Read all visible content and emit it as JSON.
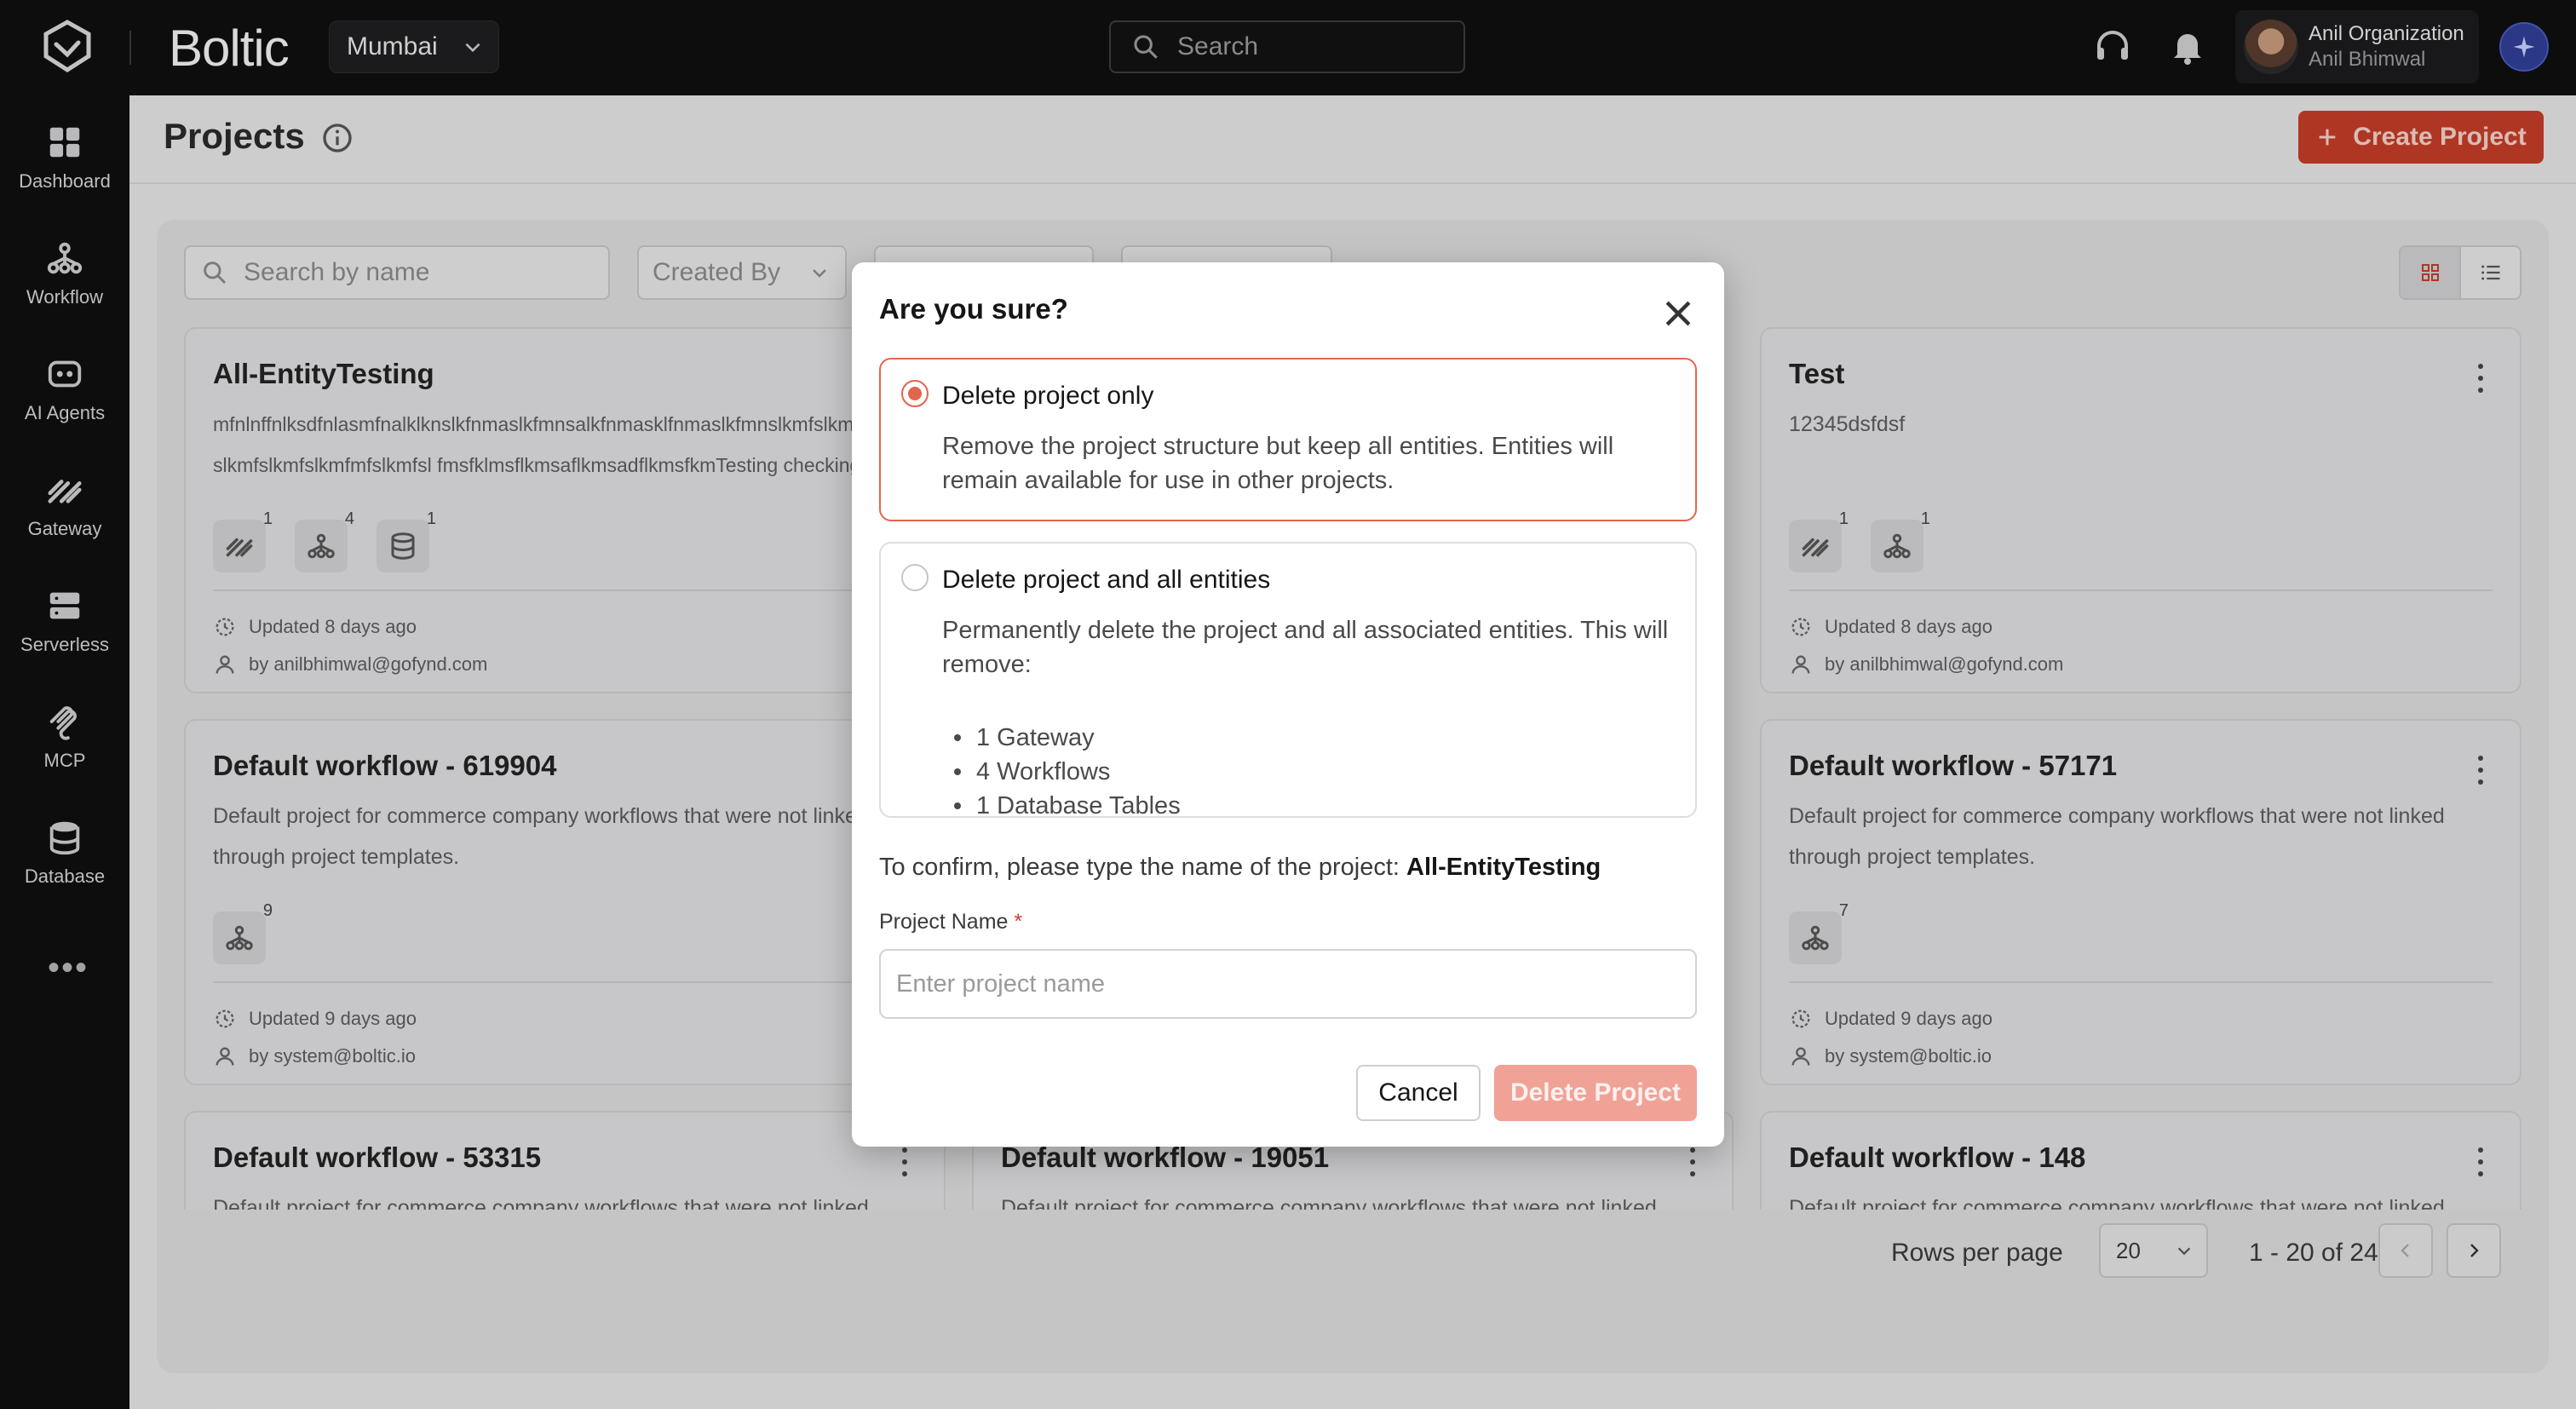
{
  "app": {
    "brand": "Boltic",
    "region": "Mumbai",
    "search_placeholder": "Search",
    "org_name": "Anil Organization",
    "user_name": "Anil Bhimwal"
  },
  "sidebar": {
    "items": [
      {
        "label": "Dashboard",
        "icon": "dashboard-icon"
      },
      {
        "label": "Workflow",
        "icon": "workflow-icon"
      },
      {
        "label": "AI Agents",
        "icon": "ai-agent-icon"
      },
      {
        "label": "Gateway",
        "icon": "gateway-icon"
      },
      {
        "label": "Serverless",
        "icon": "serverless-icon"
      },
      {
        "label": "MCP",
        "icon": "mcp-icon"
      },
      {
        "label": "Database",
        "icon": "database-icon"
      }
    ],
    "more": "•••"
  },
  "page": {
    "title": "Projects",
    "create_label": "Create Project",
    "search_placeholder": "Search by name",
    "filter_created_by": "Created By"
  },
  "cards": [
    {
      "title": "All-EntityTesting",
      "desc": "mfnlnffnlksdfnlasmfnalklknslkfnmaslkfmnsalkfnmasklfnmaslkfmnslkmfslkmfslkmfmfslkmfslkmfslkmfmfslkmfsl fmsfklmsflkmsaflkmsadflkmsfkmTesting checking Testing",
      "badges": [
        "1",
        "4",
        "1"
      ],
      "updated": "Updated 8 days ago",
      "by": "by anilbhimwal@gofynd.com"
    },
    {
      "title": "Test",
      "desc": "12345dsfdsf",
      "badges": [
        "1",
        "1"
      ],
      "updated": "Updated 8 days ago",
      "by": "by anilbhimwal@gofynd.com"
    },
    {
      "title": "Default workflow - 619904",
      "desc": "Default project for commerce company workflows that were not linked through project templates.",
      "badges": [
        "9"
      ],
      "updated": "Updated 9 days ago",
      "by": "by system@boltic.io"
    },
    {
      "title": "Default workflow - 57171",
      "desc": "Default project for commerce company workflows that were not linked through project templates.",
      "badges": [
        "7"
      ],
      "updated": "Updated 9 days ago",
      "by": "by system@boltic.io"
    },
    {
      "title": "Default workflow - 53315",
      "desc": "Default project for commerce company workflows that were not linked through project templates."
    },
    {
      "title": "Default workflow - 19051",
      "desc": "Default project for commerce company workflows that were not linked through project templates."
    },
    {
      "title": "Default workflow - 148",
      "desc": "Default project for commerce company workflows that were not linked through project templates."
    }
  ],
  "pagination": {
    "rows_label": "Rows per page",
    "rows_value": "20",
    "range": "1 - 20 of 24"
  },
  "modal": {
    "title": "Are you sure?",
    "option1_title": "Delete project only",
    "option1_desc": "Remove the project structure but keep all entities. Entities will remain available for use in other projects.",
    "option2_title": "Delete project and all entities",
    "option2_desc": "Permanently delete the project and all associated entities. This will remove:",
    "option2_items": [
      "1 Gateway",
      "4 Workflows",
      "1 Database Tables"
    ],
    "confirm_prefix": "To confirm, please type the name of the project:",
    "confirm_name": "All-EntityTesting",
    "field_label": "Project Name",
    "field_required": "*",
    "field_placeholder": "Enter project name",
    "cancel_label": "Cancel",
    "delete_label": "Delete Project"
  },
  "colors": {
    "accent": "#c33d27",
    "selected_border": "#e3654d",
    "delete_disabled": "#f0a297"
  }
}
